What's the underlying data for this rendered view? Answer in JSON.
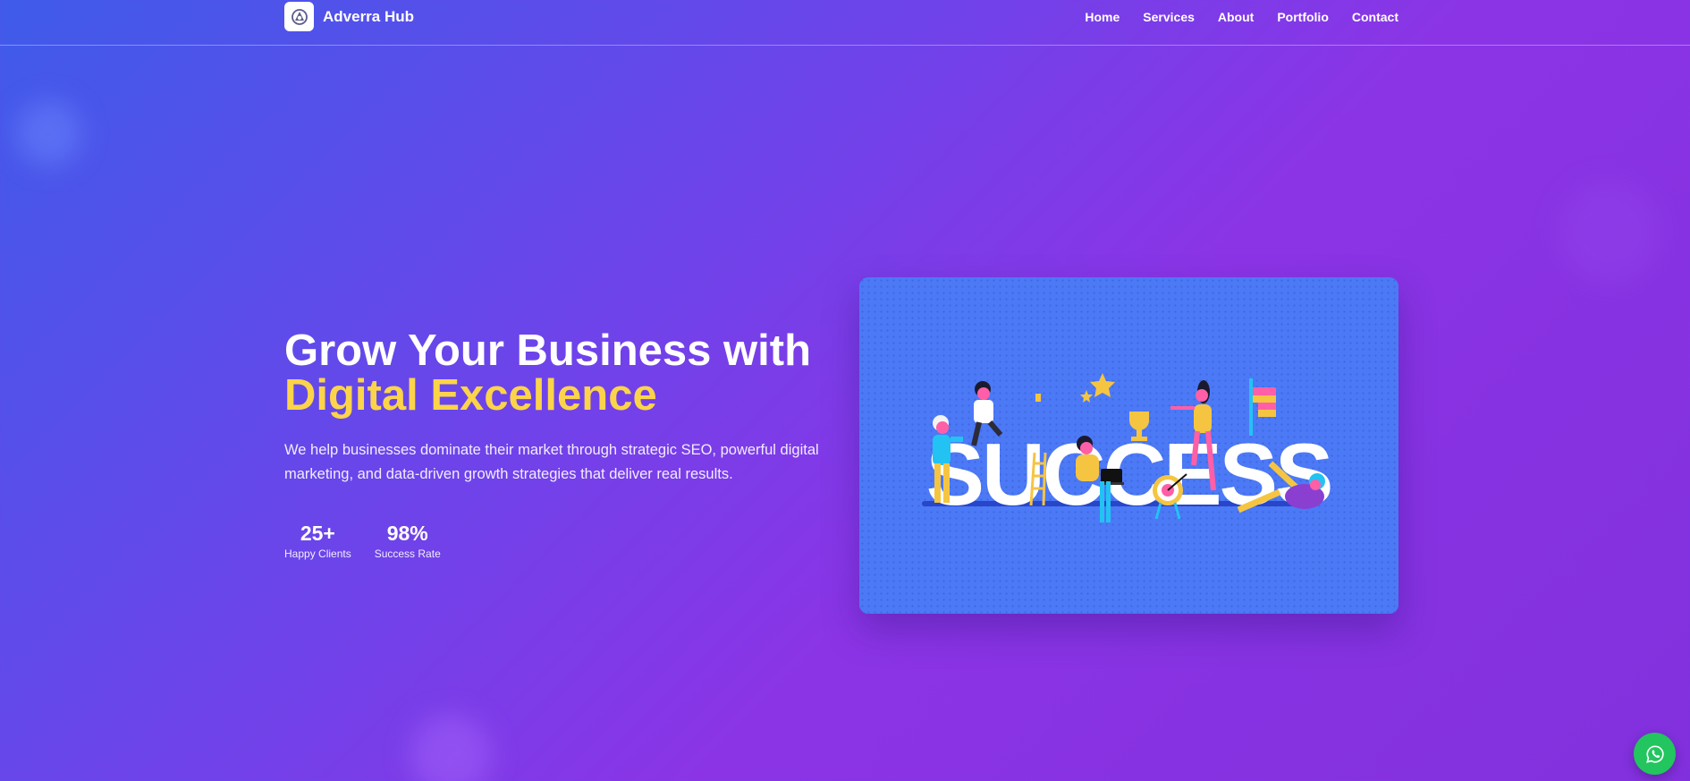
{
  "brand": {
    "name": "Adverra Hub",
    "logo_icon": "logo-icon"
  },
  "nav": {
    "links": [
      {
        "label": "Home"
      },
      {
        "label": "Services"
      },
      {
        "label": "About"
      },
      {
        "label": "Portfolio"
      },
      {
        "label": "Contact"
      }
    ]
  },
  "hero": {
    "title_line1": "Grow Your Business with",
    "title_highlight": "Digital Excellence",
    "subtitle": "We help businesses dominate their market through strategic SEO, powerful digital marketing, and data-driven growth strategies that deliver real results.",
    "stats": [
      {
        "value": "25+",
        "label": "Happy Clients"
      },
      {
        "value": "98%",
        "label": "Success Rate"
      }
    ],
    "illustration": {
      "word": "SUCCESS",
      "icon": "success-illustration"
    }
  },
  "floating": {
    "whatsapp_icon": "whatsapp-icon"
  },
  "colors": {
    "accent": "#fbd44a",
    "background_start": "#3f5bea",
    "background_end": "#8b34e6",
    "card": "#4c79f6",
    "whatsapp": "#22c55e"
  }
}
